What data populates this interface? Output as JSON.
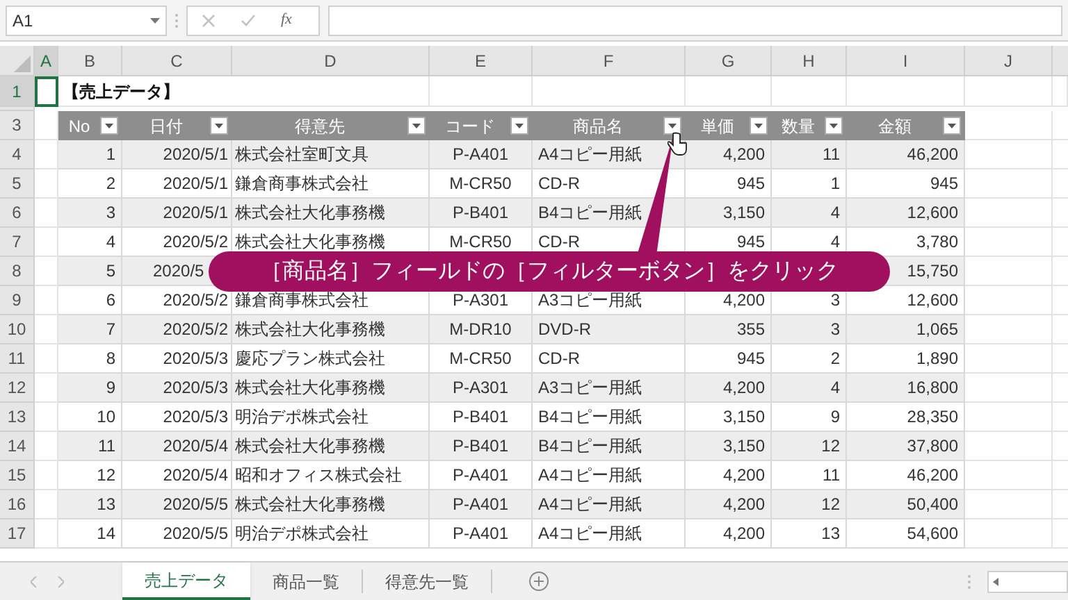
{
  "name_box": "A1",
  "function_label": "fx",
  "columns": [
    {
      "label": "A",
      "selected": true
    },
    {
      "label": "B",
      "selected": false
    },
    {
      "label": "C",
      "selected": false
    },
    {
      "label": "D",
      "selected": false
    },
    {
      "label": "E",
      "selected": false
    },
    {
      "label": "F",
      "selected": false
    },
    {
      "label": "G",
      "selected": false
    },
    {
      "label": "H",
      "selected": false
    },
    {
      "label": "I",
      "selected": false
    },
    {
      "label": "J",
      "selected": false
    }
  ],
  "row_numbers": [
    {
      "label": "1",
      "selected": true
    },
    {
      "label": "3",
      "selected": false
    },
    {
      "label": "4",
      "selected": false
    },
    {
      "label": "5",
      "selected": false
    },
    {
      "label": "6",
      "selected": false
    },
    {
      "label": "7",
      "selected": false
    },
    {
      "label": "8",
      "selected": false
    },
    {
      "label": "9",
      "selected": false
    },
    {
      "label": "10",
      "selected": false
    },
    {
      "label": "11",
      "selected": false
    },
    {
      "label": "12",
      "selected": false
    },
    {
      "label": "13",
      "selected": false
    },
    {
      "label": "14",
      "selected": false
    },
    {
      "label": "15",
      "selected": false
    },
    {
      "label": "16",
      "selected": false
    },
    {
      "label": "17",
      "selected": false
    }
  ],
  "sheet_title": "【売上データ】",
  "table": {
    "columns": [
      "No",
      "日付",
      "得意先",
      "コード",
      "商品名",
      "単価",
      "数量",
      "金額"
    ],
    "rows": [
      {
        "no": "1",
        "date": "2020/5/1",
        "customer": "株式会社室町文具",
        "code": "P-A401",
        "product": "A4コピー用紙",
        "price": "4,200",
        "qty": "11",
        "total": "46,200"
      },
      {
        "no": "2",
        "date": "2020/5/1",
        "customer": "鎌倉商事株式会社",
        "code": "M-CR50",
        "product": "CD-R",
        "price": "945",
        "qty": "1",
        "total": "945"
      },
      {
        "no": "3",
        "date": "2020/5/1",
        "customer": "株式会社大化事務機",
        "code": "P-B401",
        "product": "B4コピー用紙",
        "price": "3,150",
        "qty": "4",
        "total": "12,600"
      },
      {
        "no": "4",
        "date": "2020/5/2",
        "customer": "株式会社大化事務機",
        "code": "M-CR50",
        "product": "CD-R",
        "price": "945",
        "qty": "4",
        "total": "3,780"
      },
      {
        "no": "5",
        "date": "2020/5",
        "total": "15,750"
      },
      {
        "no": "6",
        "date": "2020/5/2",
        "customer": "鎌倉商事株式会社",
        "code": "P-A301",
        "product": "A3コピー用紙",
        "price": "4,200",
        "qty": "3",
        "total": "12,600"
      },
      {
        "no": "7",
        "date": "2020/5/2",
        "customer": "株式会社大化事務機",
        "code": "M-DR10",
        "product": "DVD-R",
        "price": "355",
        "qty": "3",
        "total": "1,065"
      },
      {
        "no": "8",
        "date": "2020/5/3",
        "customer": "慶応プラン株式会社",
        "code": "M-CR50",
        "product": "CD-R",
        "price": "945",
        "qty": "2",
        "total": "1,890"
      },
      {
        "no": "9",
        "date": "2020/5/3",
        "customer": "株式会社大化事務機",
        "code": "P-A301",
        "product": "A3コピー用紙",
        "price": "4,200",
        "qty": "4",
        "total": "16,800"
      },
      {
        "no": "10",
        "date": "2020/5/3",
        "customer": "明治デポ株式会社",
        "code": "P-B401",
        "product": "B4コピー用紙",
        "price": "3,150",
        "qty": "9",
        "total": "28,350"
      },
      {
        "no": "11",
        "date": "2020/5/4",
        "customer": "株式会社大化事務機",
        "code": "P-B401",
        "product": "B4コピー用紙",
        "price": "3,150",
        "qty": "12",
        "total": "37,800"
      },
      {
        "no": "12",
        "date": "2020/5/4",
        "customer": "昭和オフィス株式会社",
        "code": "P-A401",
        "product": "A4コピー用紙",
        "price": "4,200",
        "qty": "11",
        "total": "46,200"
      },
      {
        "no": "13",
        "date": "2020/5/5",
        "customer": "株式会社大化事務機",
        "code": "P-A401",
        "product": "A4コピー用紙",
        "price": "4,200",
        "qty": "12",
        "total": "50,400"
      },
      {
        "no": "14",
        "date": "2020/5/5",
        "customer": "明治デポ株式会社",
        "code": "P-A401",
        "product": "A4コピー用紙",
        "price": "4,200",
        "qty": "13",
        "total": "54,600"
      }
    ]
  },
  "callout": "［商品名］フィールドの［フィルターボタン］をクリック",
  "sheet_tabs": [
    {
      "label": "売上データ",
      "selected": true
    },
    {
      "label": "商品一覧",
      "selected": false
    },
    {
      "label": "得意先一覧",
      "selected": false
    }
  ]
}
